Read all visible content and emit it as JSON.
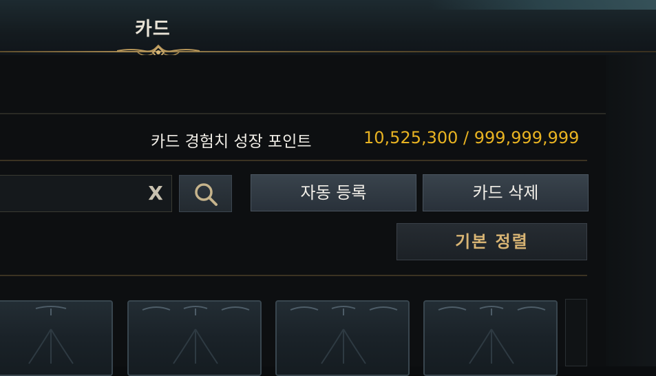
{
  "header": {
    "title": "카드"
  },
  "exp": {
    "label": "카드 경험치 성장 포인트",
    "value": "10,525,300 / 999,999,999"
  },
  "search": {
    "clear_label": "X",
    "placeholder": ""
  },
  "buttons": {
    "auto_register": "자동 등록",
    "delete_card": "카드 삭제",
    "sort": "기본 정렬"
  },
  "colors": {
    "accent_gold": "#e8b322",
    "sort_text": "#d9b574",
    "button_bg": "#323b44"
  },
  "icons": {
    "search": "search-icon",
    "clear": "clear-icon",
    "ornament": "ornament-icon"
  }
}
